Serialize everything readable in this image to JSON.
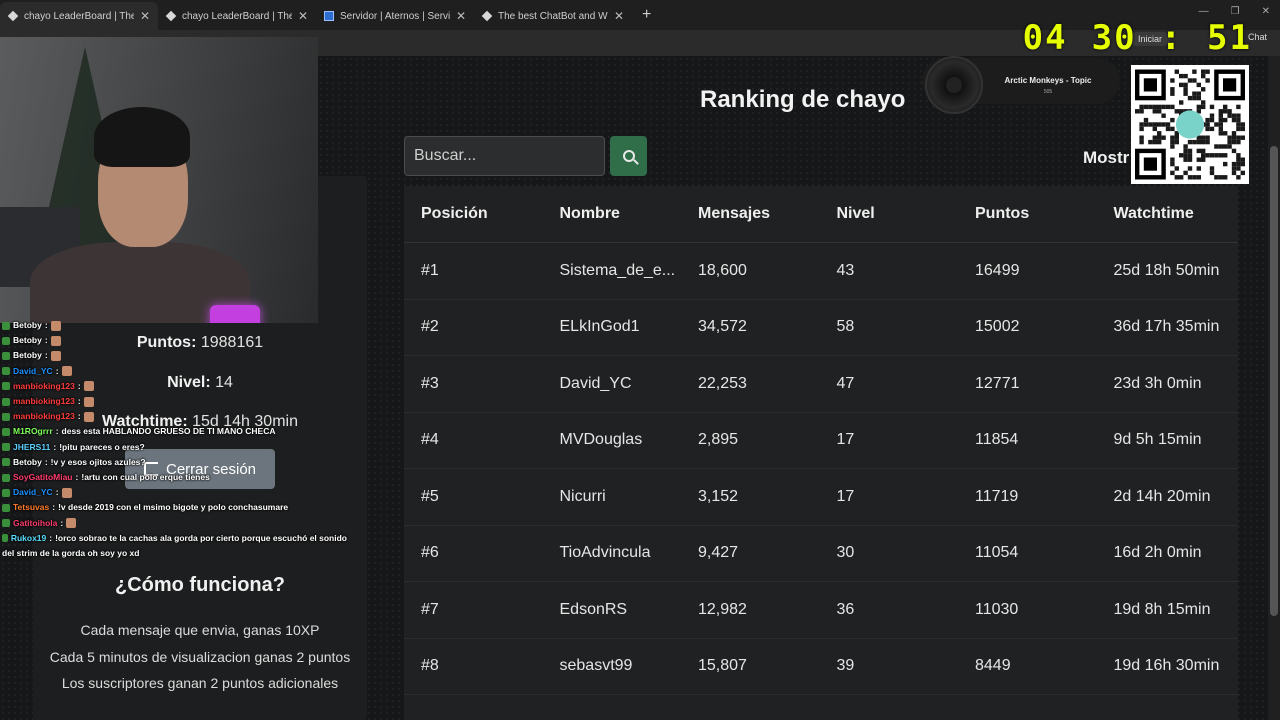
{
  "browser": {
    "tabs": [
      {
        "title": "chayo LeaderBoard | The best Chat",
        "active": true
      },
      {
        "title": "chayo LeaderBoard | The best Chat",
        "active": false
      },
      {
        "title": "Servidor | Aternos | Servidor de M",
        "active": false
      },
      {
        "title": "The best ChatBot and Widgets for",
        "active": false
      }
    ],
    "iniciar_label": "Iniciar",
    "chat_label": "Chat"
  },
  "overlay": {
    "clock": {
      "h": "04",
      "m": "30",
      "sep": ":",
      "s": "51"
    },
    "now_playing": {
      "title": "Arctic Monkeys - Topic",
      "sub": "505"
    }
  },
  "profile": {
    "puntos_label": "Puntos:",
    "puntos_value": "1988161",
    "nivel_label": "Nivel:",
    "nivel_value": "14",
    "watch_label": "Watchtime:",
    "watch_value": "15d 14h 30min",
    "logout_label": "Cerrar sesión"
  },
  "how": {
    "title": "¿Cómo funciona?",
    "lines": [
      "Cada mensaje que envia, ganas 10XP",
      "Cada 5 minutos de visualizacion ganas 2 puntos",
      "Los suscriptores ganan 2 puntos adicionales"
    ]
  },
  "ranking": {
    "title": "Ranking de chayo",
    "search_placeholder": "Buscar...",
    "mostrar_label": "Mostr",
    "columns": [
      "Posición",
      "Nombre",
      "Mensajes",
      "Nivel",
      "Puntos",
      "Watchtime"
    ],
    "rows": [
      [
        "#1",
        "Sistema_de_e...",
        "18,600",
        "43",
        "16499",
        "25d 18h 50min"
      ],
      [
        "#2",
        "ELkInGod1",
        "34,572",
        "58",
        "15002",
        "36d 17h 35min"
      ],
      [
        "#3",
        "David_YC",
        "22,253",
        "47",
        "12771",
        "23d 3h 0min"
      ],
      [
        "#4",
        "MVDouglas",
        "2,895",
        "17",
        "11854",
        "9d 5h 15min"
      ],
      [
        "#5",
        "Nicurri",
        "3,152",
        "17",
        "11719",
        "2d 14h 20min"
      ],
      [
        "#6",
        "TioAdvincula",
        "9,427",
        "30",
        "11054",
        "16d 2h 0min"
      ],
      [
        "#7",
        "EdsonRS",
        "12,982",
        "36",
        "11030",
        "19d 8h 15min"
      ],
      [
        "#8",
        "sebasvt99",
        "15,807",
        "39",
        "8449",
        "19d 16h 30min"
      ]
    ]
  },
  "chat": {
    "messages": [
      {
        "user": "Betoby",
        "color": "#ffffff",
        "text": ""
      },
      {
        "user": "Betoby",
        "color": "#ffffff",
        "text": ""
      },
      {
        "user": "Betoby",
        "color": "#ffffff",
        "text": ""
      },
      {
        "user": "David_YC",
        "color": "#1e90ff",
        "text": ""
      },
      {
        "user": "manbioking123",
        "color": "#ff3c3c",
        "text": ""
      },
      {
        "user": "manbioking123",
        "color": "#ff3c3c",
        "text": ""
      },
      {
        "user": "manbioking123",
        "color": "#ff3c3c",
        "text": ""
      },
      {
        "user": "M1ROgrrr",
        "color": "#7cff5a",
        "text": "dess esta HABLANDO GRUESO DE TI MANO CHECA"
      },
      {
        "user": "JHERS11",
        "color": "#5ad1ff",
        "text": "!pitu pareces o eres?"
      },
      {
        "user": "Betoby",
        "color": "#ffffff",
        "text": "!v y esos ojitos azules?"
      },
      {
        "user": "SoyGatitoMiau",
        "color": "#ff3c6e",
        "text": "!artu con cual polo erque tienes"
      },
      {
        "user": "David_YC",
        "color": "#1e90ff",
        "text": ""
      },
      {
        "user": "Tetsuvas",
        "color": "#ff7a2a",
        "text": "!v desde 2019 con el msimo bigote y polo conchasumare"
      },
      {
        "user": "Gatitoihola",
        "color": "#ff3c6e",
        "text": ""
      },
      {
        "user": "Rukox19",
        "color": "#5adfff",
        "text": "!orco sobrao te la cachas ala gorda por cierto porque escuchó el sonido"
      },
      {
        "user": "",
        "color": "#ffffff",
        "text": "del strim de la gorda oh soy yo xd"
      }
    ]
  }
}
